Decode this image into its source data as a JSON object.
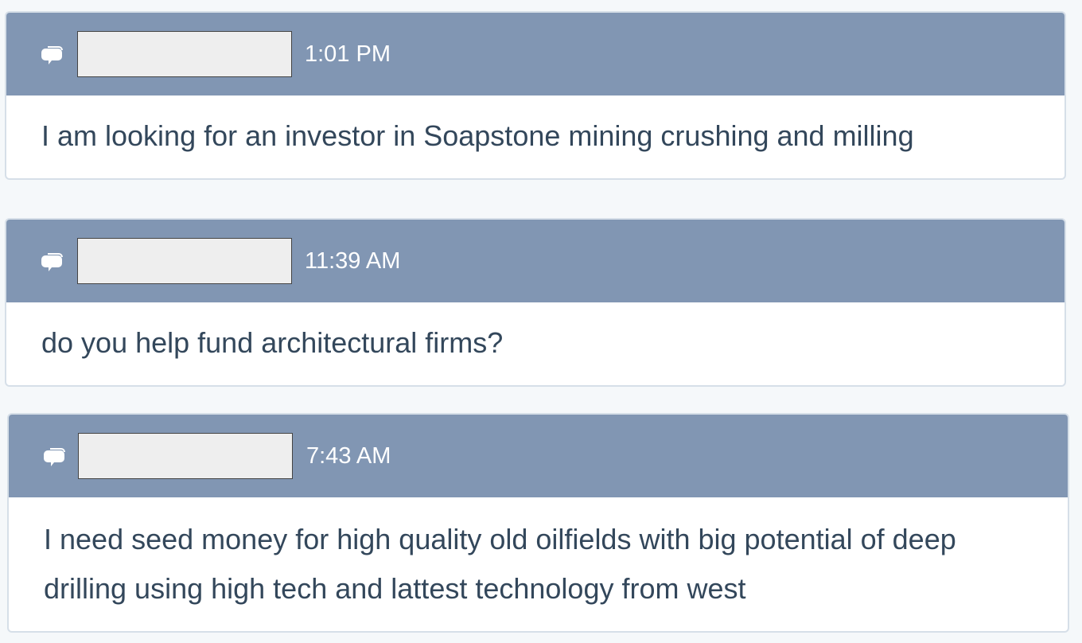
{
  "messages": [
    {
      "time": "1:01 PM",
      "text": "I am looking for an investor in Soapstone mining crushing and milling"
    },
    {
      "time": "11:39 AM",
      "text": "do you help fund architectural firms?"
    },
    {
      "time": "7:43 AM",
      "text": "I need seed money for high quality old oilfields with big potential of deep drilling using high tech and lattest technology from west"
    }
  ],
  "colors": {
    "header": "#8196b3",
    "body_text": "#33475b",
    "page_bg": "#f5f8fa",
    "card_border": "#d6dfe8"
  },
  "icons": {
    "chat": "chat-bubbles-icon"
  }
}
